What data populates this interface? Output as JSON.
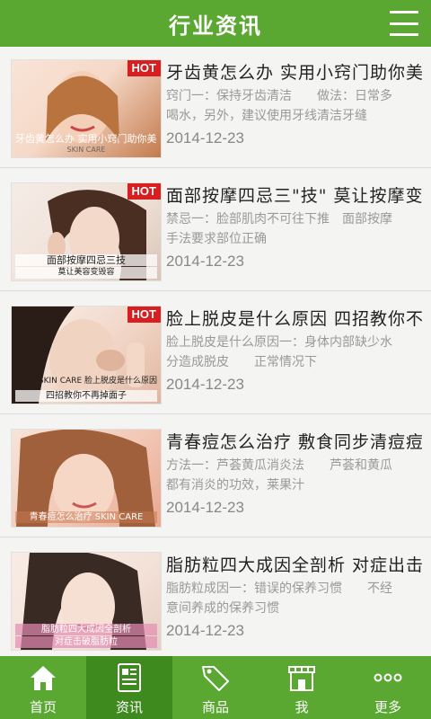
{
  "header": {
    "title": "行业资讯",
    "menu_icon": "hamburger-menu-icon"
  },
  "articles": [
    {
      "title": "牙齿黄怎么办 实用小窍门助你美白牙齿",
      "desc": "窍门一：保持牙齿清洁　　做法：日常多喝水，另外，建议使用牙线清洁牙缝",
      "date": "2014-12-23",
      "badge": "HOT",
      "thumb_caption": "牙齿黄怎么办 实用小窍门助你美白牙齿",
      "thumb_caption_sub": "SKIN CARE",
      "thumb_colors": [
        "#f6d9c8",
        "#c47a4c"
      ]
    },
    {
      "title": "面部按摩四忌三\"技\" 莫让按摩变伤害",
      "desc": "禁忌一：脸部肌肉不可往下推　面部按摩手法要求部位正确",
      "date": "2014-12-23",
      "badge": "HOT",
      "thumb_caption": "面部按摩四忌三技",
      "thumb_caption_sub": "莫让美容变毁容",
      "thumb_colors": [
        "#efe0d6",
        "#5a3a2a"
      ]
    },
    {
      "title": "脸上脱皮是什么原因 四招教你不再掉面子",
      "desc": "脸上脱皮是什么原因一：身体内部缺少水分造成脱皮　　正常情况下",
      "date": "2014-12-23",
      "badge": "HOT",
      "thumb_caption": "SKIN CARE 脸上脱皮是什么原因",
      "thumb_caption_sub": "四招教你不再掉面子",
      "thumb_colors": [
        "#f0d4c4",
        "#e0b5a0"
      ]
    },
    {
      "title": "青春痘怎么治疗 敷食同步清痘痘",
      "desc": "方法一：芦荟黄瓜消炎法　　芦荟和黄瓜都有消炎的功效，莱果汁",
      "date": "2014-12-23",
      "badge": "",
      "thumb_caption": "青春痘怎么治疗 SKIN CARE",
      "thumb_caption_sub": "",
      "thumb_colors": [
        "#f2c8b6",
        "#9a5a3a"
      ]
    },
    {
      "title": "脂肪粒四大成因全剖析 对症出击",
      "desc": "脂肪粒成因一：错误的保养习惯　　不经意间养成的保养习惯",
      "date": "2014-12-23",
      "badge": "",
      "thumb_caption": "脂肪粒四大成因全剖析",
      "thumb_caption_sub": "对症击破脂肪粒",
      "thumb_colors": [
        "#f4e2d8",
        "#3a2a24"
      ]
    }
  ],
  "tabs": [
    {
      "label": "首页",
      "icon": "home-icon",
      "active": false
    },
    {
      "label": "资讯",
      "icon": "news-icon",
      "active": true
    },
    {
      "label": "商品",
      "icon": "tag-icon",
      "active": false
    },
    {
      "label": "我",
      "icon": "store-icon",
      "active": false
    },
    {
      "label": "更多",
      "icon": "more-dots-icon",
      "active": false
    }
  ],
  "colors": {
    "brand_green": "#5aa832",
    "active_tab": "#3f8a1f",
    "hot_red": "#d81e1e"
  }
}
